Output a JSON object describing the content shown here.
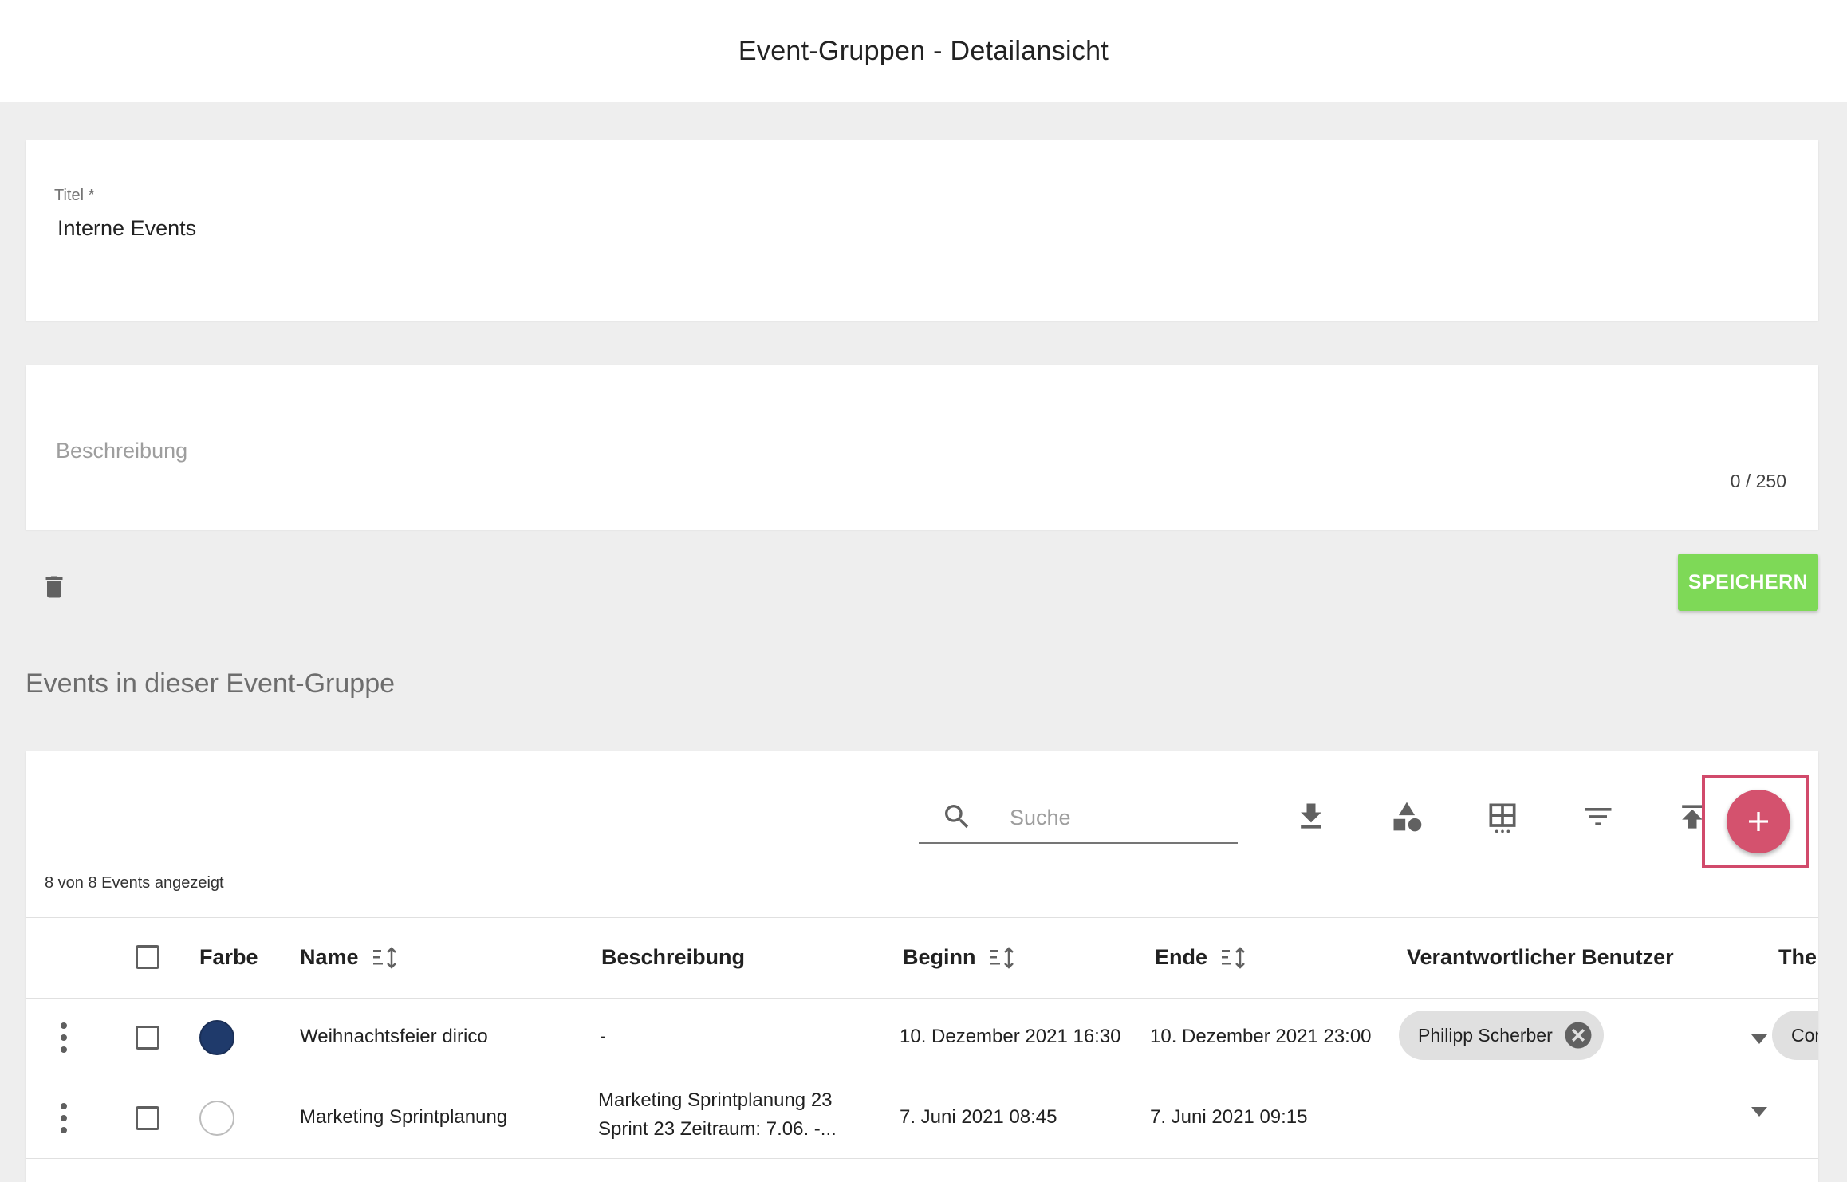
{
  "header": {
    "title": "Event-Gruppen - Detailansicht"
  },
  "form": {
    "title_label": "Titel *",
    "title_value": "Interne Events",
    "description_placeholder": "Beschreibung",
    "description_counter": "0 / 250",
    "save_label": "SPEICHERN"
  },
  "events": {
    "section_title": "Events in dieser Event-Gruppe",
    "search_placeholder": "Suche",
    "count_text": "8 von 8 Events angezeigt",
    "columns": {
      "farbe": "Farbe",
      "name": "Name",
      "beschreibung": "Beschreibung",
      "beginn": "Beginn",
      "ende": "Ende",
      "verantwortlich": "Verantwortlicher Benutzer",
      "thema": "The"
    },
    "rows": [
      {
        "color": "#1f3a6b",
        "name": "Weihnachtsfeier dirico",
        "description": "-",
        "description_line2": "",
        "begin": "10. Dezember 2021 16:30",
        "end": "10. Dezember 2021 23:00",
        "responsible": "Philipp Scherber",
        "theme": "Cor"
      },
      {
        "color": "#ffffff",
        "name": "Marketing Sprintplanung",
        "description": "Marketing Sprintplanung 23",
        "description_line2": "Sprint 23 Zeitraum: 7.06. -...",
        "begin": "7. Juni 2021 08:45",
        "end": "7. Juni 2021 09:15",
        "responsible": "",
        "theme": ""
      }
    ]
  },
  "icons": {
    "trash": "trash-icon",
    "search": "search-icon",
    "download": "download-icon",
    "shapes": "shapes-icon",
    "columns": "table-columns-icon",
    "filter": "filter-icon",
    "upload": "upload-icon",
    "add": "plus-icon"
  },
  "colors": {
    "save_button": "#7ed957",
    "add_button": "#d4526e",
    "highlight": "#d14a6b"
  }
}
